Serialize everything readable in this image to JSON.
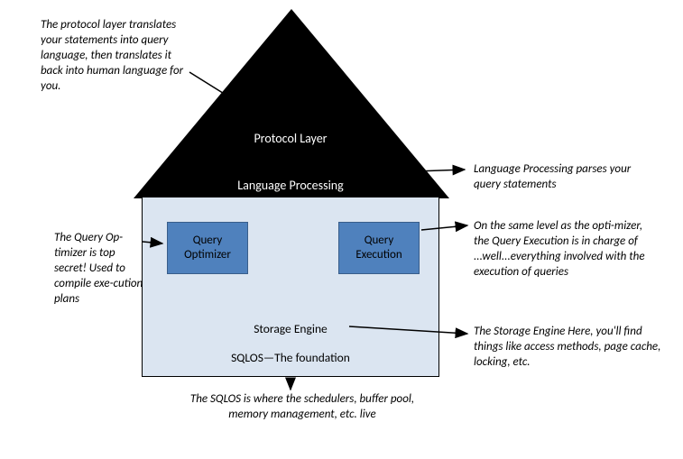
{
  "roof": {
    "top_label": "Protocol Layer",
    "bottom_label": "Language Processing"
  },
  "boxes": {
    "optimizer": "Query\nOptimizer",
    "execution": "Query\nExecution"
  },
  "body_labels": {
    "storage": "Storage Engine",
    "sqlos": "SQLOS—The foundation"
  },
  "annotations": {
    "protocol": "The protocol layer translates your statements into query language, then translates it back into human language for you.",
    "language_processing": "Language Processing parses your query statements",
    "optimizer": "The Query Op-timizer is top secret!  Used to compile exe-cution plans",
    "execution": "On the same level as the opti-mizer, the  Query Execution is in charge of ...well...everything involved with the execution of queries",
    "storage": "The Storage Engine   Here, you'll find things  like access methods, page cache, locking, etc.",
    "sqlos": "The SQLOS is where the schedulers, buffer pool, memory management, etc. live"
  }
}
